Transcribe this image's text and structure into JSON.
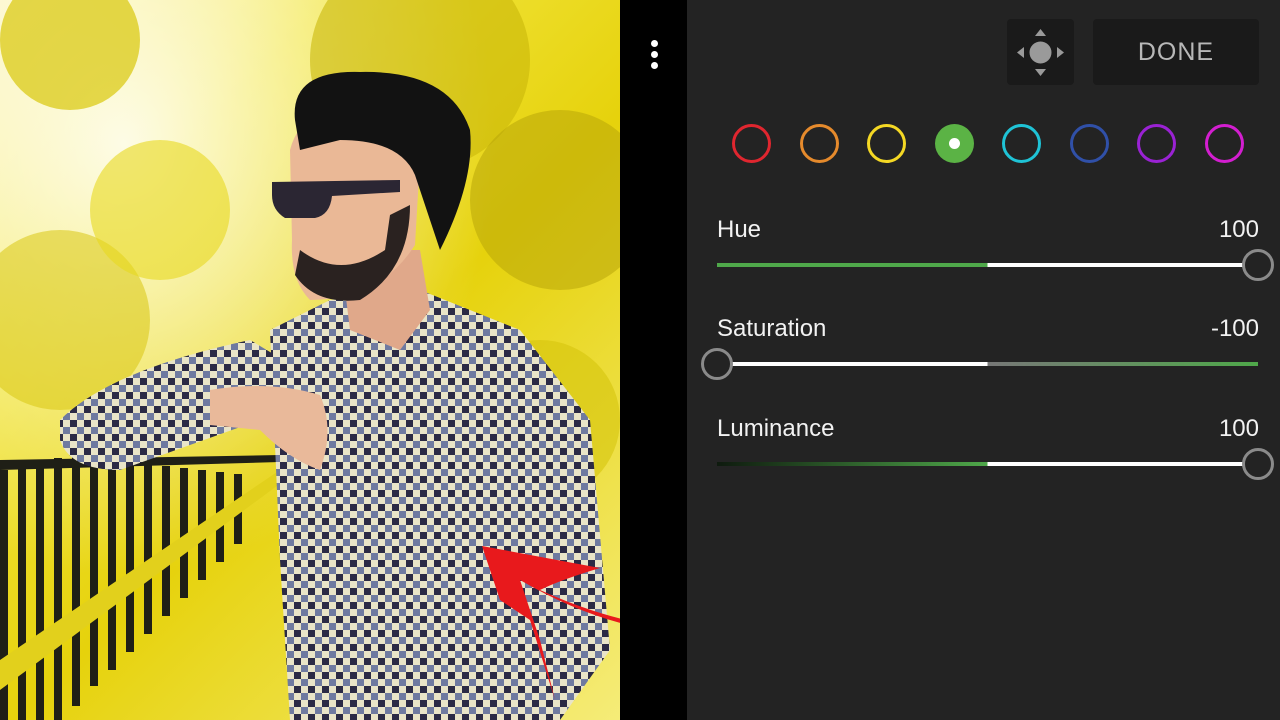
{
  "toolbar": {
    "more_icon": "more-vertical-icon",
    "target_icon": "targeted-adjustment-icon",
    "done_label": "DONE"
  },
  "color_swatches": [
    {
      "name": "red",
      "color": "#e0262f",
      "selected": false
    },
    {
      "name": "orange",
      "color": "#e58a2c",
      "selected": false
    },
    {
      "name": "yellow",
      "color": "#f4d824",
      "selected": false
    },
    {
      "name": "green",
      "color": "#5bb345",
      "selected": true
    },
    {
      "name": "aqua",
      "color": "#1fc3d6",
      "selected": false
    },
    {
      "name": "blue",
      "color": "#3050a8",
      "selected": false
    },
    {
      "name": "purple",
      "color": "#9a22d4",
      "selected": false
    },
    {
      "name": "magenta",
      "color": "#d31ed0",
      "selected": false
    }
  ],
  "sliders": {
    "hue": {
      "label": "Hue",
      "value": "100",
      "position": 1.0
    },
    "saturation": {
      "label": "Saturation",
      "value": "-100",
      "position": 0.0
    },
    "luminance": {
      "label": "Luminance",
      "value": "100",
      "position": 1.0
    }
  },
  "colors": {
    "panel_bg": "#232323",
    "accent_green": "#4fa84a",
    "track_white": "#ffffff",
    "annotation_arrow": "#e8191c"
  }
}
